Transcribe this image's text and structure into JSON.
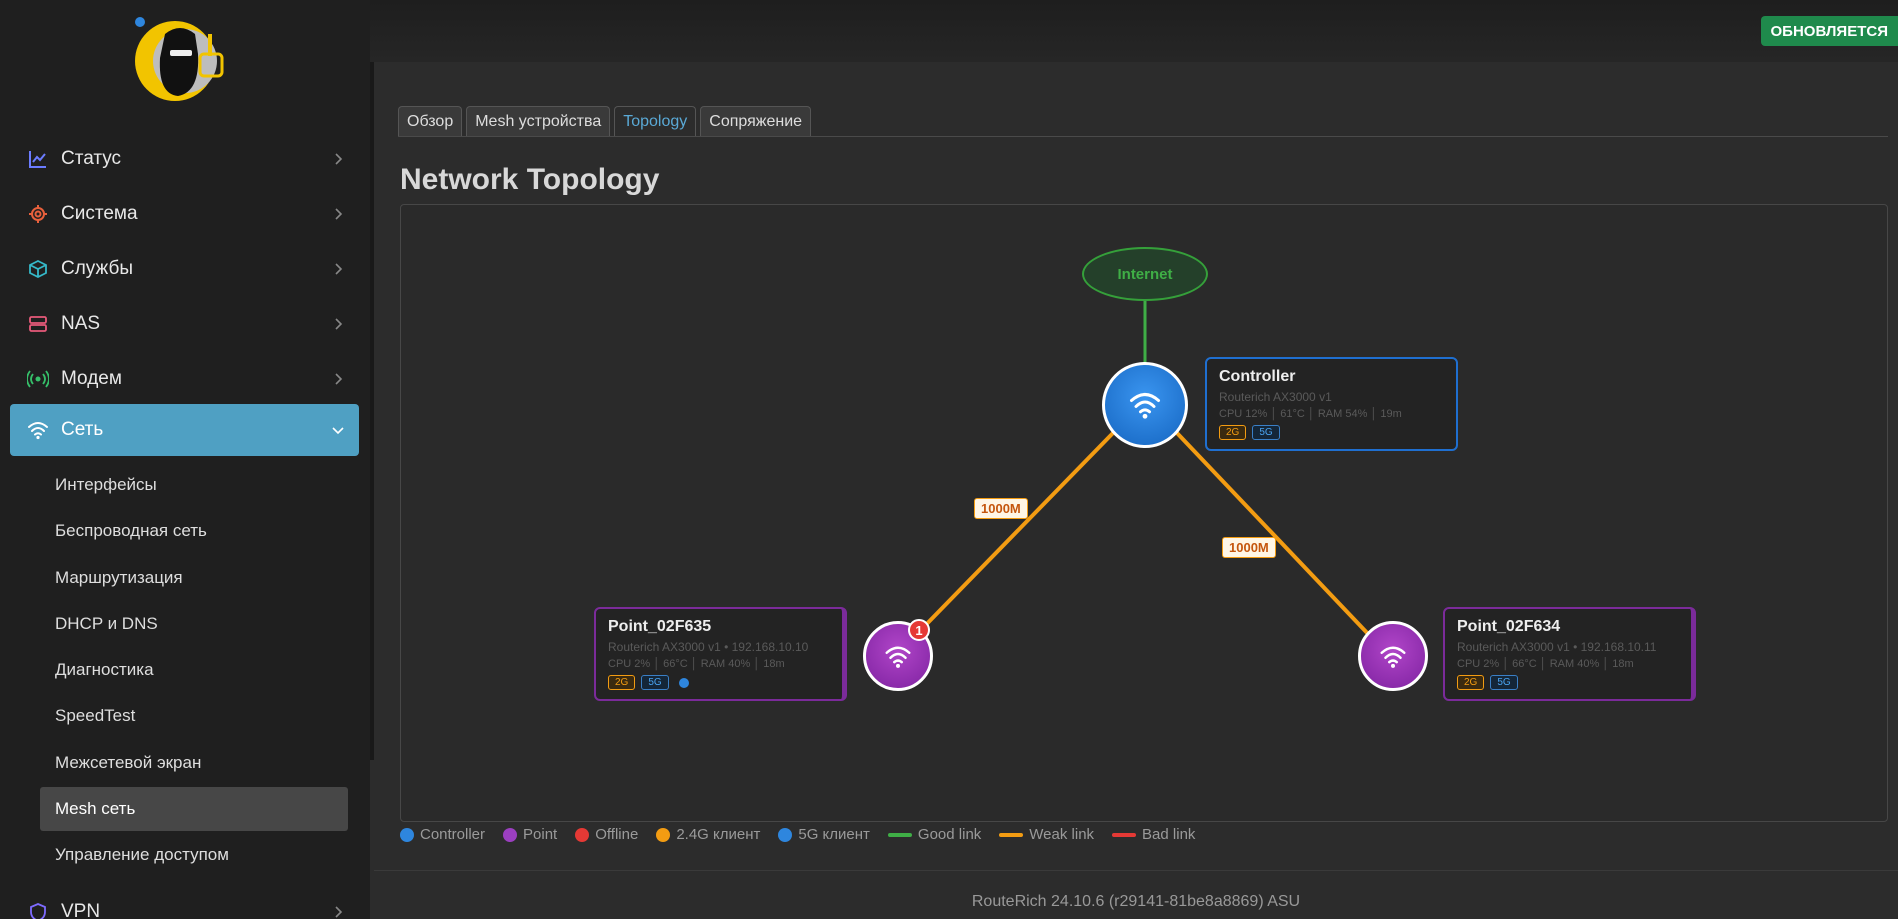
{
  "status_badge": "ОБНОВЛЯЕТСЯ",
  "sidebar": {
    "items": [
      {
        "label": "Статус",
        "icon": "chart-line-icon"
      },
      {
        "label": "Система",
        "icon": "gear-icon"
      },
      {
        "label": "Службы",
        "icon": "cube-icon"
      },
      {
        "label": "NAS",
        "icon": "server-icon"
      },
      {
        "label": "Модем",
        "icon": "broadcast-icon"
      },
      {
        "label": "Сеть",
        "icon": "wifi-icon"
      },
      {
        "label": "VPN",
        "icon": "shield-icon"
      }
    ],
    "subitems": [
      "Интерфейсы",
      "Беспроводная сеть",
      "Маршрутизация",
      "DHCP и DNS",
      "Диагностика",
      "SpeedTest",
      "Межсетевой экран",
      "Mesh сеть",
      "Управление доступом"
    ],
    "active_subitem": "Mesh сеть"
  },
  "tabs": [
    "Обзор",
    "Mesh устройства",
    "Topology",
    "Сопряжение"
  ],
  "active_tab": "Topology",
  "page_title": "Network Topology",
  "topology": {
    "internet_label": "Internet",
    "controller": {
      "name": "Controller",
      "model": "Routerich AX3000 v1",
      "stats": "CPU 12% │ 61°C │ RAM 54% │ 19m",
      "bands": [
        "2G",
        "5G"
      ]
    },
    "points": [
      {
        "name": "Point_02F635",
        "model": "Routerich AX3000 v1 • 192.168.10.10",
        "stats": "CPU 2% │ 66°C │ RAM 40% │ 18m",
        "bands": [
          "2G",
          "5G"
        ],
        "clients": "1",
        "link_speed": "1000M"
      },
      {
        "name": "Point_02F634",
        "model": "Routerich AX3000 v1 • 192.168.10.11",
        "stats": "CPU 2% │ 66°C │ RAM 40% │ 18m",
        "bands": [
          "2G",
          "5G"
        ],
        "link_speed": "1000M"
      }
    ]
  },
  "legend": [
    {
      "label": "Controller",
      "kind": "dot",
      "color": "#2e86de"
    },
    {
      "label": "Point",
      "kind": "dot",
      "color": "#9b3fc0"
    },
    {
      "label": "Offline",
      "kind": "dot",
      "color": "#e53935"
    },
    {
      "label": "2.4G клиент",
      "kind": "dot",
      "color": "#f39c12"
    },
    {
      "label": "5G клиент",
      "kind": "dot",
      "color": "#2e86de"
    },
    {
      "label": "Good link",
      "kind": "line",
      "color": "#3fae46"
    },
    {
      "label": "Weak link",
      "kind": "line",
      "color": "#f39c12"
    },
    {
      "label": "Bad link",
      "kind": "line",
      "color": "#e53935"
    }
  ],
  "footer": "RouteRich 24.10.6 (r29141-81be8a8869) ASU",
  "colors": {
    "accent": "#4fa0c3",
    "controller": "#1f6fd0",
    "point": "#7b2b9a",
    "weak_link": "#f39c12",
    "good_link": "#3fae46"
  }
}
